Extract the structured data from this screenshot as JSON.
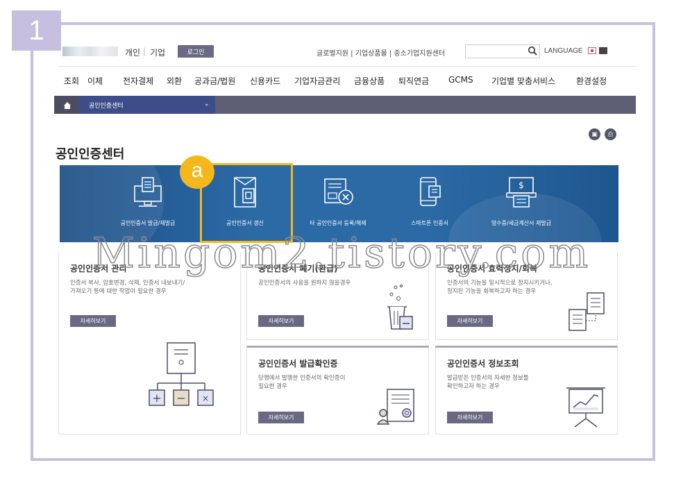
{
  "step_number": "1",
  "step_marker": "a",
  "header": {
    "seg_personal": "개인",
    "seg_separator": "|",
    "seg_corporate": "기업",
    "login": "로그인",
    "top_links": "글로벌지원 | 기업상품몰 | 중소기업지원센터",
    "language": "LANGUAGE"
  },
  "gnb": [
    "조회",
    "이체",
    "전자결제",
    "외환",
    "공과금/법원",
    "신용카드",
    "기업자금관리",
    "금융상품",
    "퇴직연금",
    "GCMS",
    "기업별 맞춤서비스",
    "환경설정"
  ],
  "location": {
    "current": "공인인증센터"
  },
  "page_title": "공인인증센터",
  "services": [
    {
      "label": "공인인증서 발급/재발급",
      "icon": "computer-icon"
    },
    {
      "label": "공인인증서 갱신",
      "icon": "certificate-folder-icon"
    },
    {
      "label": "타 공인인증서 등록/해제",
      "icon": "certificate-delete-icon"
    },
    {
      "label": "스마트폰 인증서",
      "icon": "smartphone-icon"
    },
    {
      "label": "영수증/세금계산서 재발급",
      "icon": "receipt-icon"
    }
  ],
  "watermark": "Mingom2.tistory.com",
  "cards": {
    "manage": {
      "title": "공인인증서 관리",
      "desc": "인증서 복사, 암호변경, 삭제, 인증서 내보내기/\n가져오기 등에 대한 작업이 필요한 경우",
      "button": "자세히보기"
    },
    "revoke": {
      "title": "공인인증서 폐기(환급)",
      "desc": "공인인증서의 사용을 원하지 않을경우",
      "button": "자세히보기"
    },
    "suspend": {
      "title": "공인인증서 효력정지/회복",
      "desc": "인증서의 기능을 일시적으로 정지시키거나,\n정지된 기능을 회복하고자 하는 경우",
      "button": "자세히보기"
    },
    "confirm": {
      "title": "공인인증서 발급확인증",
      "desc": "당행에서 발행한 인증서의 확인증이\n필요한 경우",
      "button": "자세히보기"
    },
    "info": {
      "title": "공인인증서 정보조회",
      "desc": "발급받은 인증서의 자세한 정보를\n확인하고자 하는 경우",
      "button": "자세히보기"
    }
  },
  "colors": {
    "accent": "#3e4d8a",
    "highlight": "#f4b81c",
    "frame": "#c7bfdf",
    "banner": "#2c6aa6"
  }
}
